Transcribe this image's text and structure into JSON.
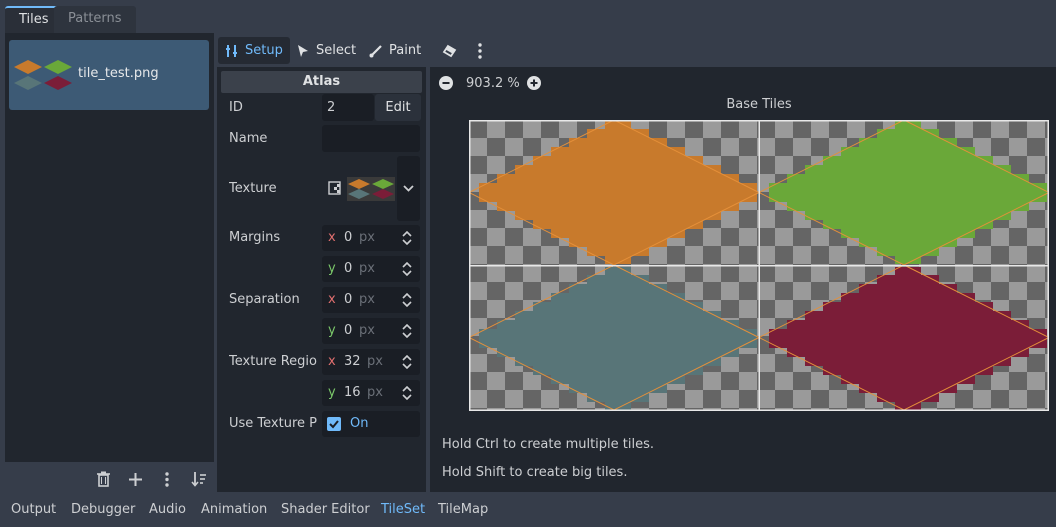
{
  "top_tabs": {
    "tiles": "Tiles",
    "patterns": "Patterns"
  },
  "sources": {
    "items": [
      {
        "label": "tile_test.png"
      }
    ]
  },
  "toolbar": {
    "setup": "Setup",
    "select": "Select",
    "paint": "Paint"
  },
  "inspector": {
    "header": "Atlas",
    "id_label": "ID",
    "id_value": "2",
    "edit_label": "Edit",
    "name_label": "Name",
    "name_value": "",
    "texture_label": "Texture",
    "margins_label": "Margins",
    "margins_x": "0",
    "margins_y": "0",
    "separation_label": "Separation",
    "separation_x": "0",
    "separation_y": "0",
    "region_label": "Texture Regio",
    "region_x": "32",
    "region_y": "16",
    "use_padding_label": "Use Texture P",
    "use_padding_value": "On",
    "unit": "px",
    "axis_x": "x",
    "axis_y": "y"
  },
  "viewport": {
    "zoom": "903.2 %",
    "title": "Base Tiles",
    "hint_1": "Hold Ctrl to create multiple tiles.",
    "hint_2": "Hold Shift to create big tiles."
  },
  "bottom_tabs": [
    "Output",
    "Debugger",
    "Audio",
    "Animation",
    "Shader Editor",
    "TileSet",
    "TileMap"
  ],
  "colors": {
    "accent": "#70bafa",
    "tile_orange": "#c87a2c",
    "tile_green": "#6aa839",
    "tile_teal": "#587578",
    "tile_maroon": "#7b1d38"
  }
}
